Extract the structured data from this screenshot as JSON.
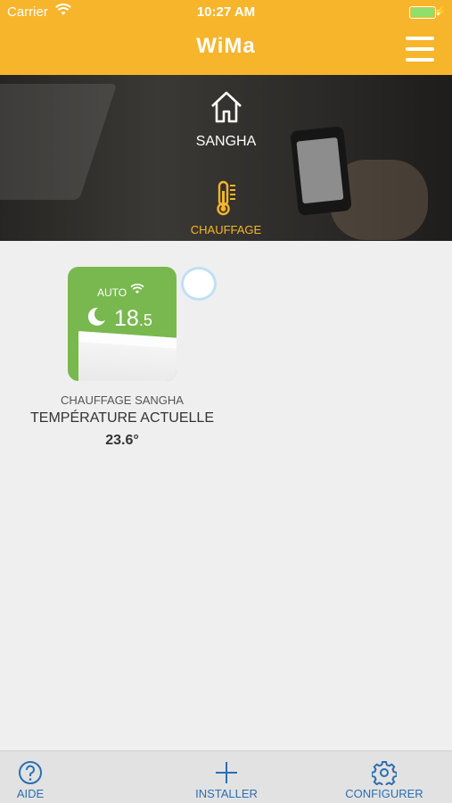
{
  "status_bar": {
    "carrier": "Carrier",
    "time": "10:27 AM",
    "wifi_icon": "wifi-icon",
    "battery_icon": "battery-icon",
    "charging_icon": "charging-bolt-icon"
  },
  "header": {
    "title": "WiMa",
    "menu_icon": "hamburger-menu-icon",
    "background_color": "#f7b52c"
  },
  "hero": {
    "home_icon": "home-icon",
    "site_name": "SANGHA",
    "section_icon": "thermometer-icon",
    "section_label": "CHAUFFAGE",
    "section_color": "#f7b52c"
  },
  "device": {
    "mode": "AUTO",
    "setpoint_integer": "18",
    "setpoint_decimal": ".5",
    "name": "CHAUFFAGE SANGHA",
    "reading_label": "TEMPÉRATURE ACTUELLE",
    "reading_value": "23.6°",
    "tile_color": "#79b84e",
    "mode_icon": "moon-icon",
    "connection_icon": "wifi-icon"
  },
  "bottom_nav": {
    "color": "#2a6fb0",
    "items": [
      {
        "label": "AIDE",
        "icon": "help-icon"
      },
      {
        "label": "INSTALLER",
        "icon": "plus-icon"
      },
      {
        "label": "CONFIGURER",
        "icon": "gear-icon"
      }
    ]
  }
}
